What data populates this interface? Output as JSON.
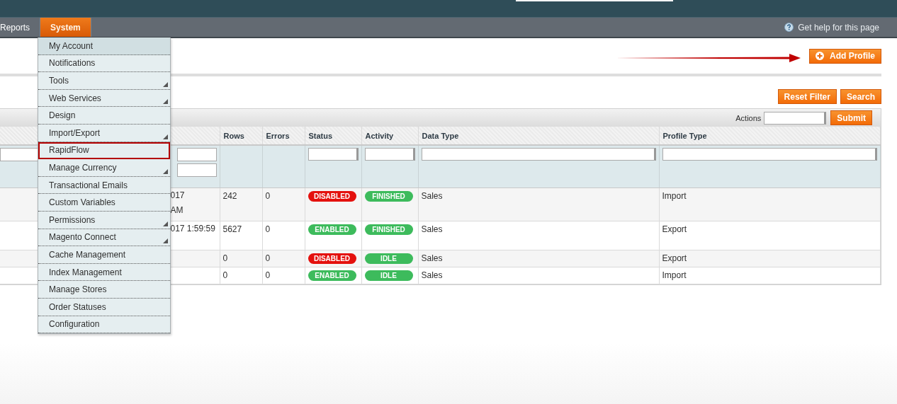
{
  "nav": {
    "items": [
      {
        "label": "Reports",
        "selected": false
      },
      {
        "label": "System",
        "selected": true
      }
    ],
    "help": "Get help for this page"
  },
  "menu": [
    {
      "label": "My Account",
      "selected": true,
      "has_submenu": false,
      "outlined": false
    },
    {
      "label": "Notifications",
      "selected": false,
      "has_submenu": false,
      "outlined": false
    },
    {
      "label": "Tools",
      "selected": false,
      "has_submenu": true,
      "outlined": false
    },
    {
      "label": "Web Services",
      "selected": false,
      "has_submenu": true,
      "outlined": false
    },
    {
      "label": "Design",
      "selected": false,
      "has_submenu": false,
      "outlined": false
    },
    {
      "label": "Import/Export",
      "selected": false,
      "has_submenu": true,
      "outlined": false
    },
    {
      "label": "RapidFlow",
      "selected": false,
      "has_submenu": false,
      "outlined": true
    },
    {
      "label": "Manage Currency",
      "selected": false,
      "has_submenu": true,
      "outlined": false
    },
    {
      "label": "Transactional Emails",
      "selected": false,
      "has_submenu": false,
      "outlined": false
    },
    {
      "label": "Custom Variables",
      "selected": false,
      "has_submenu": false,
      "outlined": false
    },
    {
      "label": "Permissions",
      "selected": false,
      "has_submenu": true,
      "outlined": false
    },
    {
      "label": "Magento Connect",
      "selected": false,
      "has_submenu": true,
      "outlined": false
    },
    {
      "label": "Cache Management",
      "selected": false,
      "has_submenu": false,
      "outlined": false
    },
    {
      "label": "Index Management",
      "selected": false,
      "has_submenu": false,
      "outlined": false
    },
    {
      "label": "Manage Stores",
      "selected": false,
      "has_submenu": false,
      "outlined": false
    },
    {
      "label": "Order Statuses",
      "selected": false,
      "has_submenu": false,
      "outlined": false
    },
    {
      "label": "Configuration",
      "selected": false,
      "has_submenu": false,
      "outlined": false
    }
  ],
  "add_button": "Add Profile",
  "filter_buttons": [
    "Reset Filter",
    "Search"
  ],
  "actions": {
    "label": "Actions",
    "submit": "Submit"
  },
  "table": {
    "columns": [
      "Rows",
      "Errors",
      "Status",
      "Activity",
      "Data Type",
      "Profile Type"
    ],
    "rows": [
      {
        "date": [
          "017",
          "AM"
        ],
        "rows": "242",
        "errors": "0",
        "status": {
          "text": "DISABLED",
          "enabled": false
        },
        "activity": "FINISHED",
        "data_type": "Sales",
        "profile_type": "Import"
      },
      {
        "date": [
          "017 1:59:59"
        ],
        "rows": "5627",
        "errors": "0",
        "status": {
          "text": "ENABLED",
          "enabled": true
        },
        "activity": "FINISHED",
        "data_type": "Sales",
        "profile_type": "Export"
      },
      {
        "date": [],
        "rows": "0",
        "errors": "0",
        "status": {
          "text": "DISABLED",
          "enabled": false
        },
        "activity": "IDLE",
        "data_type": "Sales",
        "profile_type": "Export"
      },
      {
        "date": [],
        "rows": "0",
        "errors": "0",
        "status": {
          "text": "ENABLED",
          "enabled": true
        },
        "activity": "IDLE",
        "data_type": "Sales",
        "profile_type": "Import"
      }
    ]
  }
}
